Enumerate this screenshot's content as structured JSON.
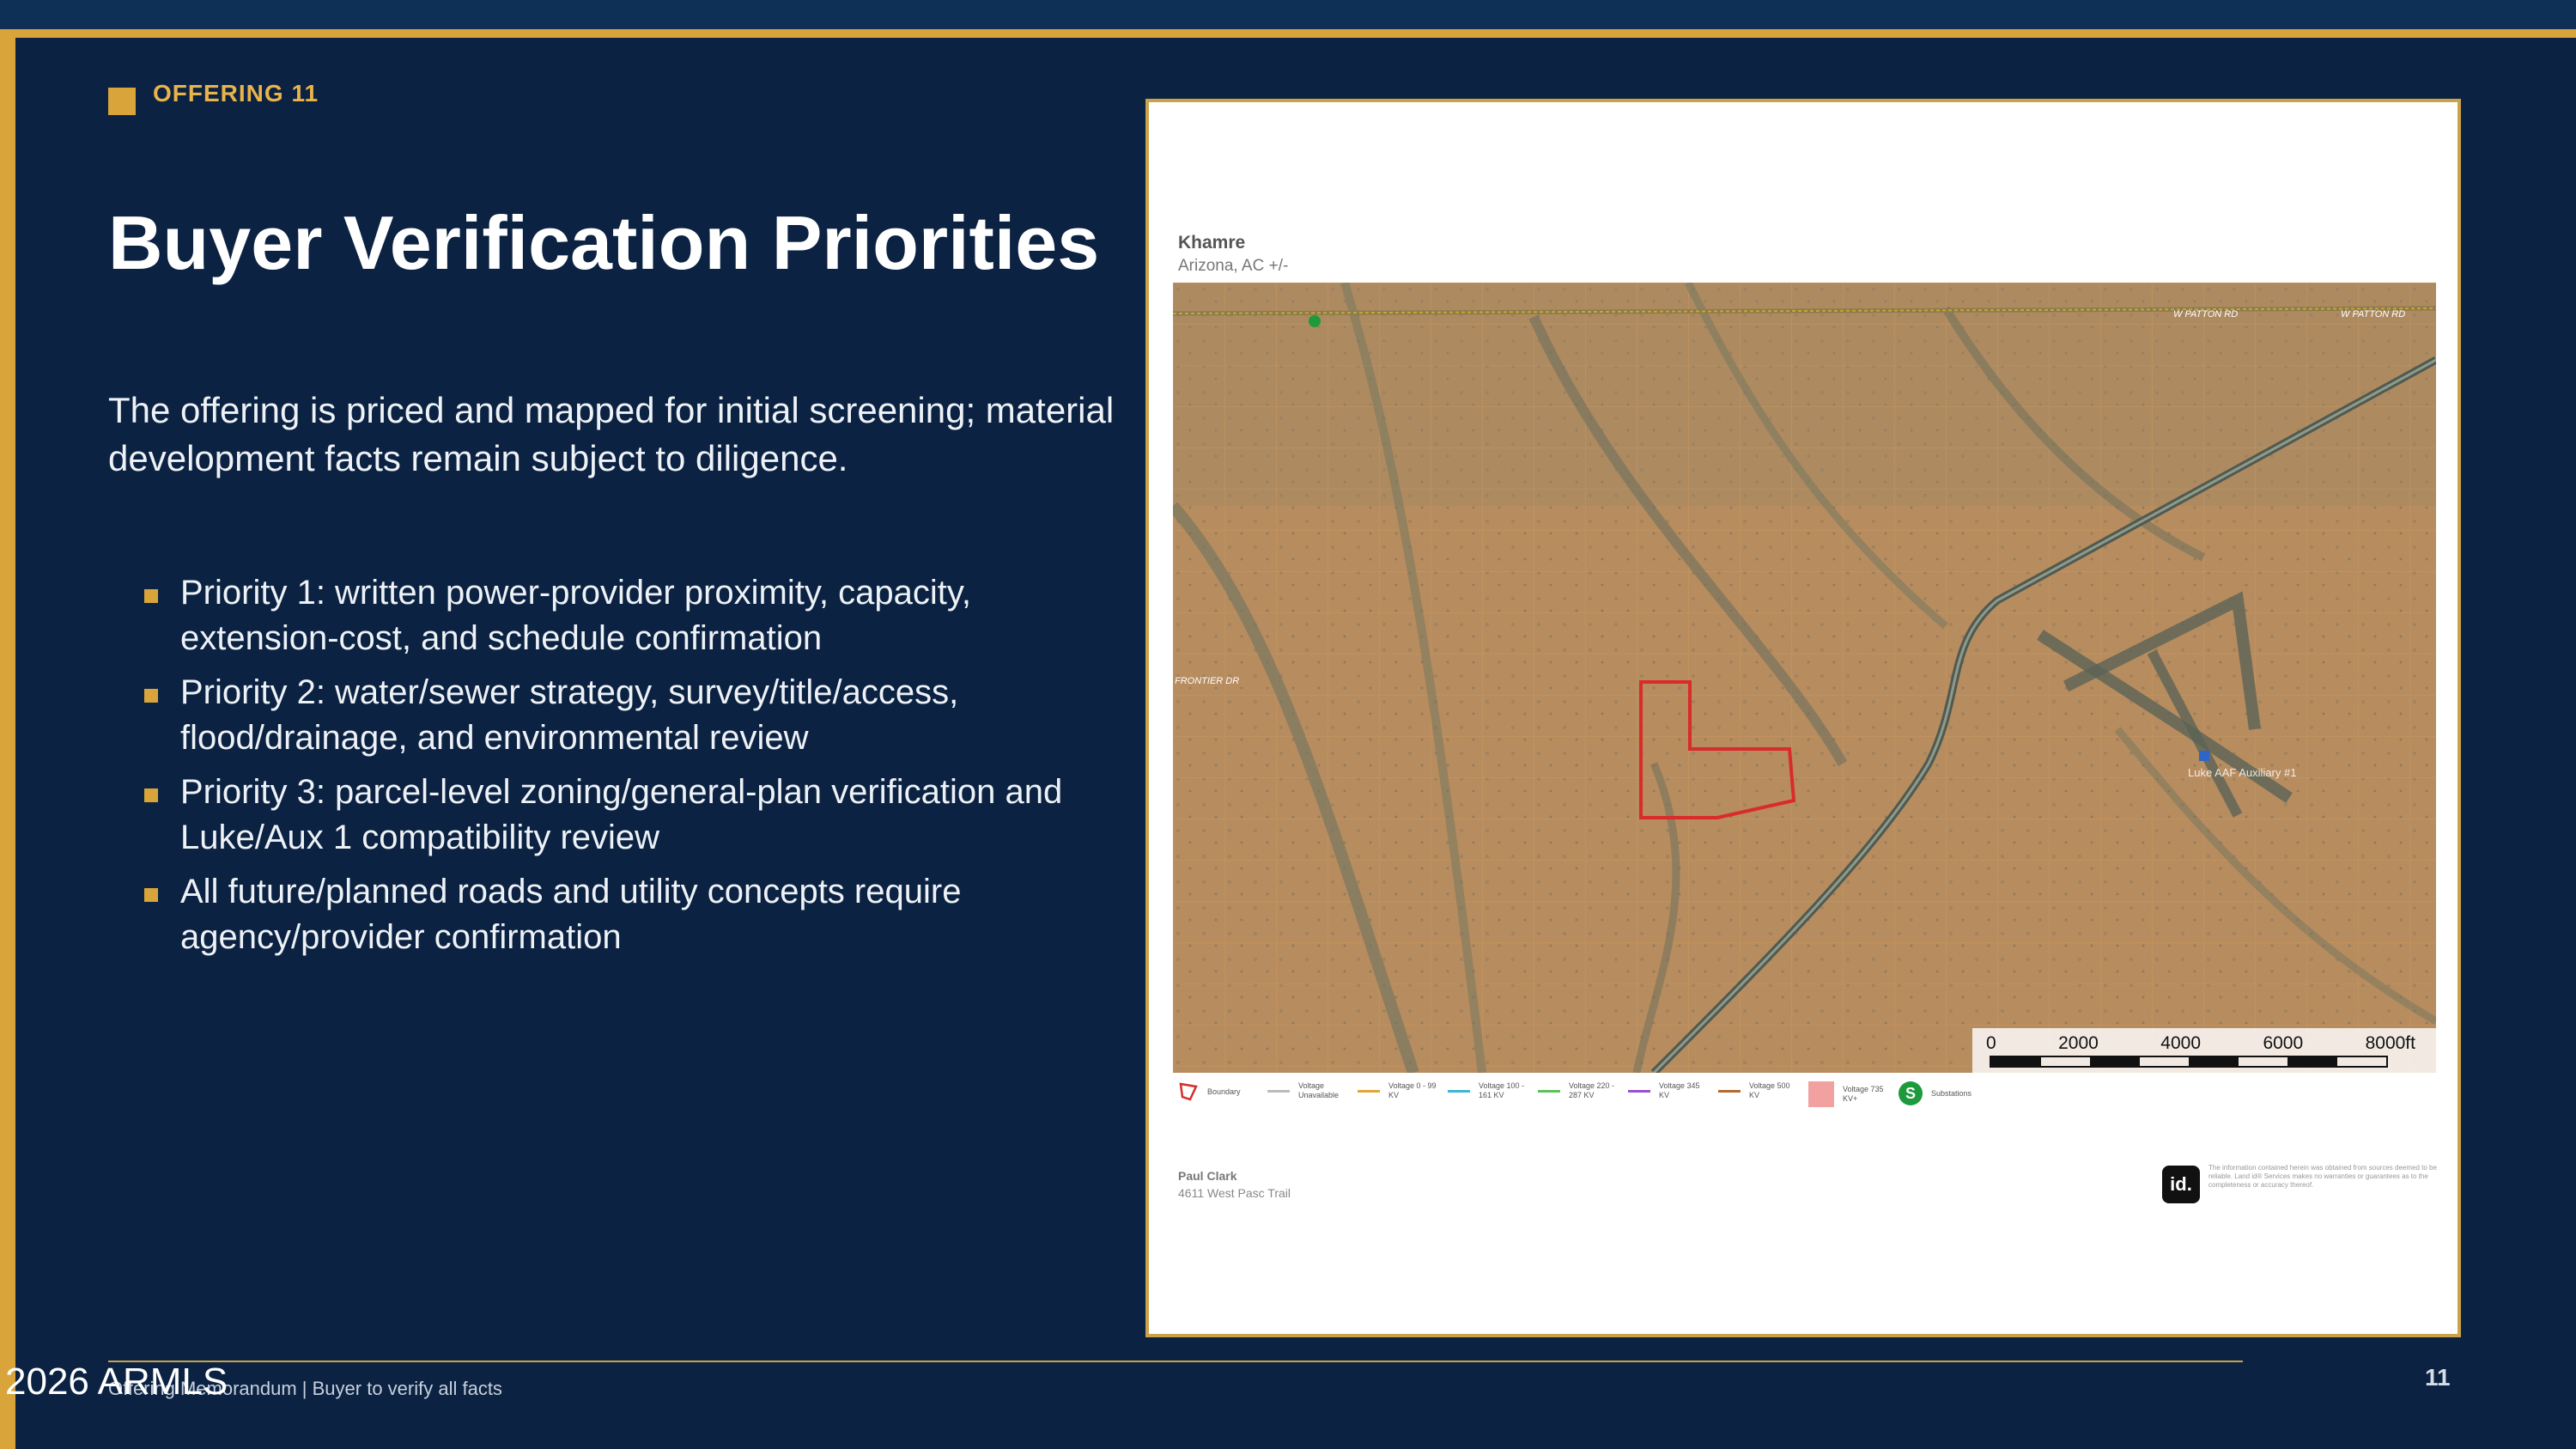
{
  "eyebrow": "OFFERING 11",
  "title": "Buyer Verification Priorities",
  "intro": "The offering is priced and mapped for initial screening; material development facts remain subject to diligence.",
  "priorities": [
    "Priority 1: written power-provider proximity, capacity, extension-cost, and schedule confirmation",
    "Priority 2: water/sewer strategy, survey/title/access, flood/drainage, and environmental review",
    "Priority 3: parcel-level zoning/general-plan verification and Luke/Aux 1 compatibility review",
    "All future/planned roads and utility concepts require agency/provider confirmation"
  ],
  "map": {
    "title": "Khamre",
    "subtitle": "Arizona,  AC +/-",
    "street_labels": {
      "patton_rd": "W PATTON RD",
      "frontier_dr": "FRONTIER DR",
      "airfield": "Luke AAF Auxiliary #1"
    },
    "scale": {
      "labels": [
        "0",
        "2000",
        "4000",
        "6000",
        "8000ft"
      ]
    },
    "legend": [
      {
        "label": "Boundary",
        "color": "#d92b2b"
      },
      {
        "label": "Voltage Unavailable",
        "color": "#bbbbbb"
      },
      {
        "label": "Voltage 0 - 99 KV",
        "color": "#e3a53a"
      },
      {
        "label": "Voltage 100 - 161 KV",
        "color": "#3fb6d9"
      },
      {
        "label": "Voltage 220 - 287 KV",
        "color": "#5cc15a"
      },
      {
        "label": "Voltage 345 KV",
        "color": "#9b4fd1"
      },
      {
        "label": "Voltage 500 KV",
        "color": "#b36a2e"
      },
      {
        "label": "Voltage 735 KV+",
        "color": "#f2a1a1"
      },
      {
        "label": "Substations",
        "color": "#1d9a3b"
      }
    ],
    "prepared_by": "Paul Clark",
    "address": "4611 West Pasc Trail",
    "logo_text": "id.",
    "disclaimer": "The information contained herein was obtained from sources deemed to be reliable. Land id® Services makes no warranties or guarantees as to the completeness or accuracy thereof."
  },
  "footer": {
    "text": "Offering Memorandum | Buyer to verify all facts",
    "page_number": "11",
    "watermark": "2026 ARMLS"
  },
  "colors": {
    "background": "#0b2242",
    "accent": "#d9a53b",
    "boundary": "#d92b2b"
  }
}
